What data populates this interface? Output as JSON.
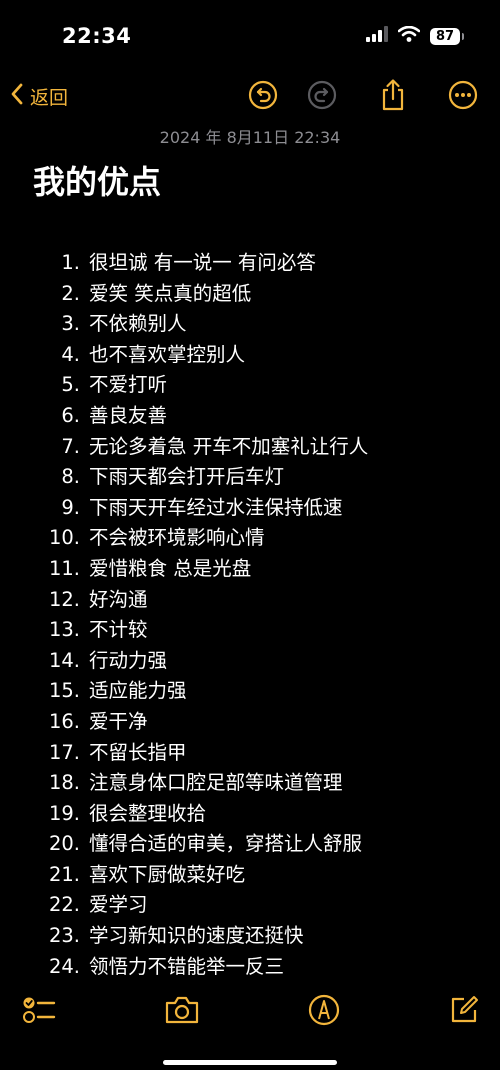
{
  "status_bar": {
    "time": "22:34",
    "battery": "87",
    "icons": [
      "signal-icon",
      "wifi-icon",
      "battery-icon"
    ]
  },
  "nav": {
    "back_label": "返回",
    "icons": [
      "undo-icon",
      "redo-icon",
      "share-icon",
      "more-icon"
    ]
  },
  "note": {
    "date": "2024 年 8月11日 22:34",
    "title": "我的优点",
    "items": [
      {
        "num": "1.",
        "text": "很坦诚 有一说一 有问必答"
      },
      {
        "num": "2.",
        "text": "爱笑 笑点真的超低"
      },
      {
        "num": "3.",
        "text": "不依赖别人"
      },
      {
        "num": "4.",
        "text": "也不喜欢掌控别人"
      },
      {
        "num": "5.",
        "text": "不爱打听"
      },
      {
        "num": "6.",
        "text": "善良友善"
      },
      {
        "num": "7.",
        "text": "无论多着急 开车不加塞礼让行人"
      },
      {
        "num": "8.",
        "text": "下雨天都会打开后车灯"
      },
      {
        "num": "9.",
        "text": "下雨天开车经过水洼保持低速"
      },
      {
        "num": "10.",
        "text": "不会被环境影响心情"
      },
      {
        "num": "11.",
        "text": "爱惜粮食 总是光盘"
      },
      {
        "num": "12.",
        "text": "好沟通"
      },
      {
        "num": "13.",
        "text": "不计较"
      },
      {
        "num": "14.",
        "text": "行动力强"
      },
      {
        "num": "15.",
        "text": "适应能力强"
      },
      {
        "num": "16.",
        "text": "爱干净"
      },
      {
        "num": "17.",
        "text": "不留长指甲"
      },
      {
        "num": "18.",
        "text": "注意身体口腔足部等味道管理"
      },
      {
        "num": "19.",
        "text": "很会整理收拾"
      },
      {
        "num": "20.",
        "text": "懂得合适的审美，穿搭让人舒服"
      },
      {
        "num": "21.",
        "text": "喜欢下厨做菜好吃"
      },
      {
        "num": "22.",
        "text": "爱学习"
      },
      {
        "num": "23.",
        "text": "学习新知识的速度还挺快"
      },
      {
        "num": "24.",
        "text": "领悟力不错能举一反三"
      }
    ]
  },
  "toolbar": {
    "icons": [
      "checklist-icon",
      "camera-icon",
      "markup-pen-icon",
      "compose-icon"
    ]
  },
  "colors": {
    "accent": "#f2b53c",
    "background": "#000000",
    "text": "#ffffff",
    "muted": "#8d8d92"
  }
}
